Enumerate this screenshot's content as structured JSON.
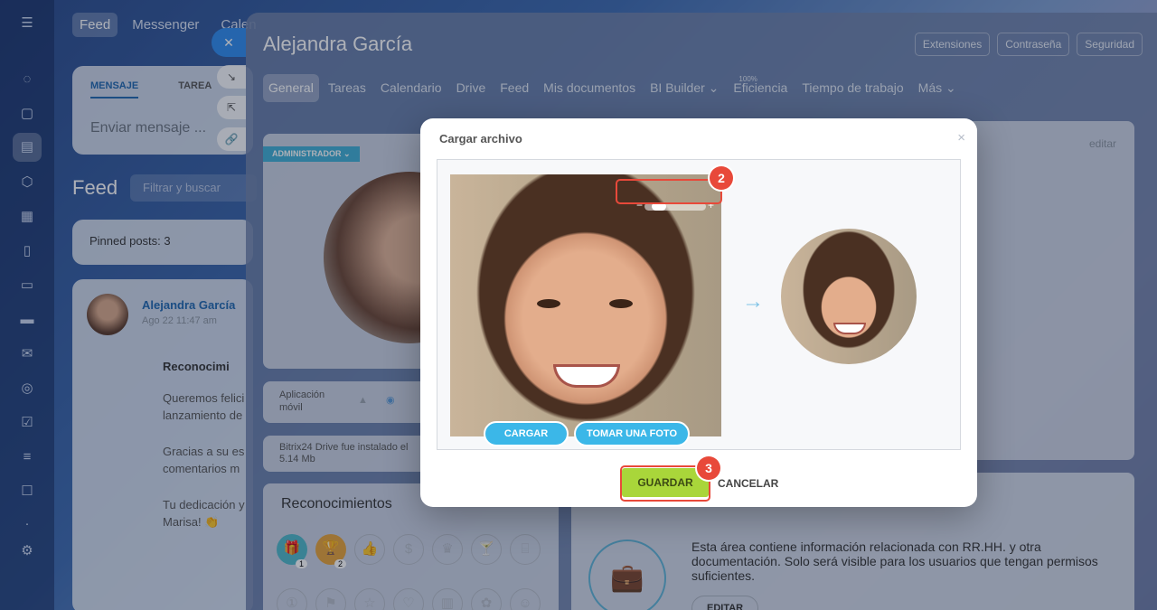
{
  "rail": {
    "icons": [
      "menu-icon",
      "chat-bubble-icon",
      "messages-icon",
      "feed-icon",
      "hexagon-icon",
      "calendar-icon",
      "document-icon",
      "presentation-icon",
      "card-icon",
      "mail-icon",
      "users-icon",
      "checkbox-icon",
      "filter-icon",
      "robot-icon",
      "dot-icon",
      "settings-icon"
    ]
  },
  "feed": {
    "nav": [
      "Feed",
      "Messenger",
      "Calen"
    ],
    "message_tabs": [
      "MENSAJE",
      "TAREA"
    ],
    "message_placeholder": "Enviar mensaje ...",
    "title": "Feed",
    "search_placeholder": "Filtrar y buscar",
    "pinned": "Pinned posts: 3",
    "post": {
      "author": "Alejandra García",
      "date": "Ago 22 11:47 am",
      "heading": "Reconocimi",
      "lines": [
        "Queremos felici",
        "lanzamiento de",
        "Gracias a su es",
        "comentarios m",
        "Tu dedicación y",
        "Marisa! 👏"
      ]
    }
  },
  "profile": {
    "name": "Alejandra García",
    "top_buttons": [
      "Extensiones",
      "Contraseña",
      "Seguridad"
    ],
    "tabs": [
      "General",
      "Tareas",
      "Calendario",
      "Drive",
      "Feed",
      "Mis documentos",
      "BI Builder ⌄",
      "Eficiencia",
      "Tiempo de trabajo",
      "Más ⌄"
    ],
    "efficiency_value": "100%",
    "badge": "ADMINISTRADOR ⌄",
    "mobile_app": "Aplicación\nmóvil",
    "drive_note": "Bitrix24 Drive fue instalado el",
    "drive_size": "5.14 Mb",
    "recognitions_title": "Reconocimientos",
    "recognition_counts": [
      "1",
      "2"
    ],
    "edit_link": "editar",
    "hr_text": "Esta área contiene información relacionada con RR.HH. y otra documentación. Solo será visible para los usuarios que tengan permisos suficientes.",
    "hr_edit": "EDITAR"
  },
  "modal": {
    "title": "Cargar archivo",
    "close": "×",
    "zoom_minus": "−",
    "zoom_plus": "+",
    "zoom_level": 0.15,
    "upload": "CARGAR",
    "take_photo": "TOMAR UNA FOTO",
    "save": "GUARDAR",
    "cancel": "CANCELAR",
    "step_2": "2",
    "step_3": "3",
    "arrow": "→"
  },
  "colors": {
    "accent": "#2f8cf0",
    "save_green": "#a9d63a",
    "highlight_red": "#e8493a",
    "upload_blue": "#3bb7e8"
  }
}
